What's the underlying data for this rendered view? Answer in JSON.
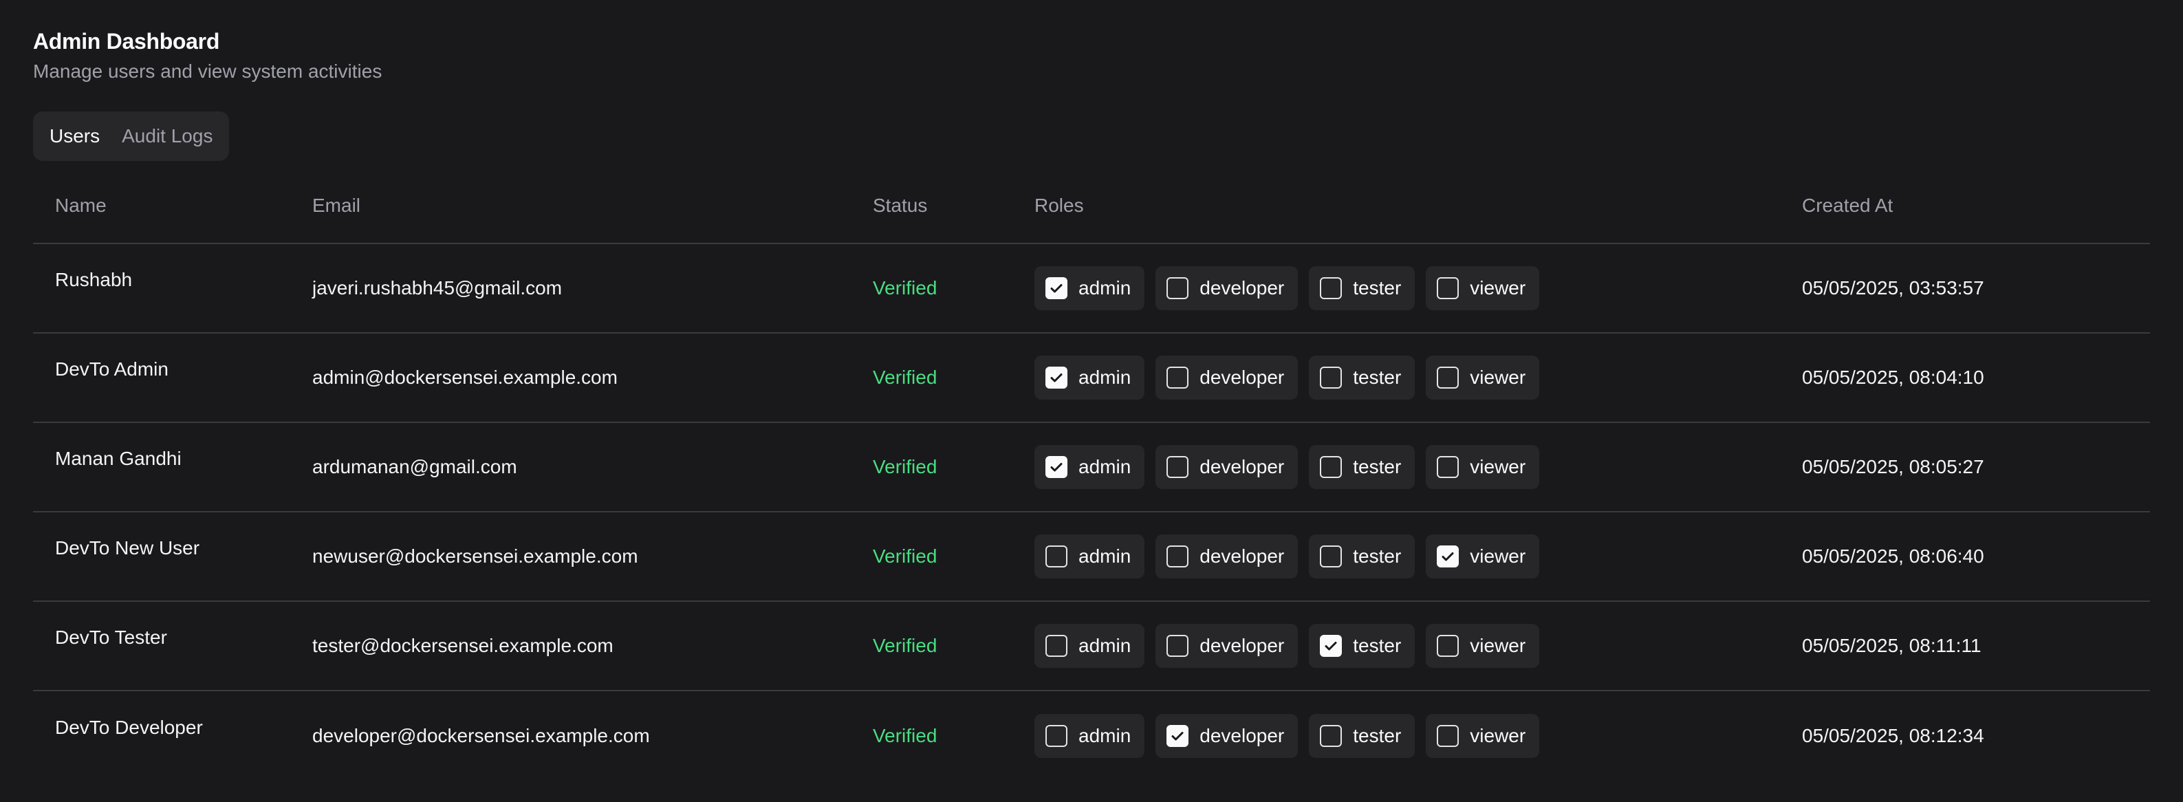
{
  "header": {
    "title": "Admin Dashboard",
    "subtitle": "Manage users and view system activities"
  },
  "tabs": [
    {
      "label": "Users",
      "active": true
    },
    {
      "label": "Audit Logs",
      "active": false
    }
  ],
  "table": {
    "columns": [
      "Name",
      "Email",
      "Status",
      "Roles",
      "Created At"
    ],
    "role_names": [
      "admin",
      "developer",
      "tester",
      "viewer"
    ],
    "rows": [
      {
        "name": "Rushabh",
        "email": "javeri.rushabh45@gmail.com",
        "status": "Verified",
        "roles": [
          true,
          false,
          false,
          false
        ],
        "created": "05/05/2025, 03:53:57"
      },
      {
        "name": "DevTo Admin",
        "email": "admin@dockersensei.example.com",
        "status": "Verified",
        "roles": [
          true,
          false,
          false,
          false
        ],
        "created": "05/05/2025, 08:04:10"
      },
      {
        "name": "Manan Gandhi",
        "email": "ardumanan@gmail.com",
        "status": "Verified",
        "roles": [
          true,
          false,
          false,
          false
        ],
        "created": "05/05/2025, 08:05:27"
      },
      {
        "name": "DevTo New User",
        "email": "newuser@dockersensei.example.com",
        "status": "Verified",
        "roles": [
          false,
          false,
          false,
          true
        ],
        "created": "05/05/2025, 08:06:40"
      },
      {
        "name": "DevTo Tester",
        "email": "tester@dockersensei.example.com",
        "status": "Verified",
        "roles": [
          false,
          false,
          true,
          false
        ],
        "created": "05/05/2025, 08:11:11"
      },
      {
        "name": "DevTo Developer",
        "email": "developer@dockersensei.example.com",
        "status": "Verified",
        "roles": [
          false,
          true,
          false,
          false
        ],
        "created": "05/05/2025, 08:12:34"
      }
    ]
  },
  "colors": {
    "background": "#19191c",
    "verified": "#4ade80",
    "chip": "#27272a"
  }
}
